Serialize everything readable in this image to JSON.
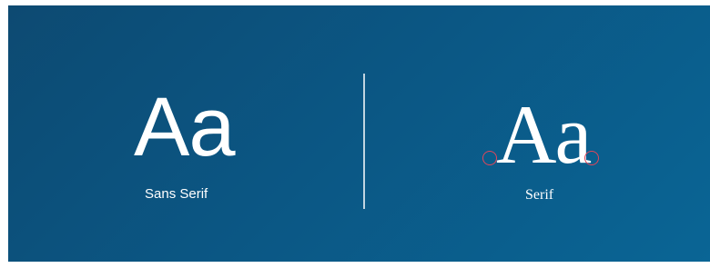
{
  "slide": {
    "left_sample": {
      "glyph": "Aa",
      "label": "Sans Serif"
    },
    "right_sample": {
      "glyph": "Aa",
      "label": "Serif"
    }
  },
  "colors": {
    "background_start": "#0d4a72",
    "background_end": "#0a6595",
    "text": "#ffffff",
    "serif_marker": "#e2465a"
  }
}
